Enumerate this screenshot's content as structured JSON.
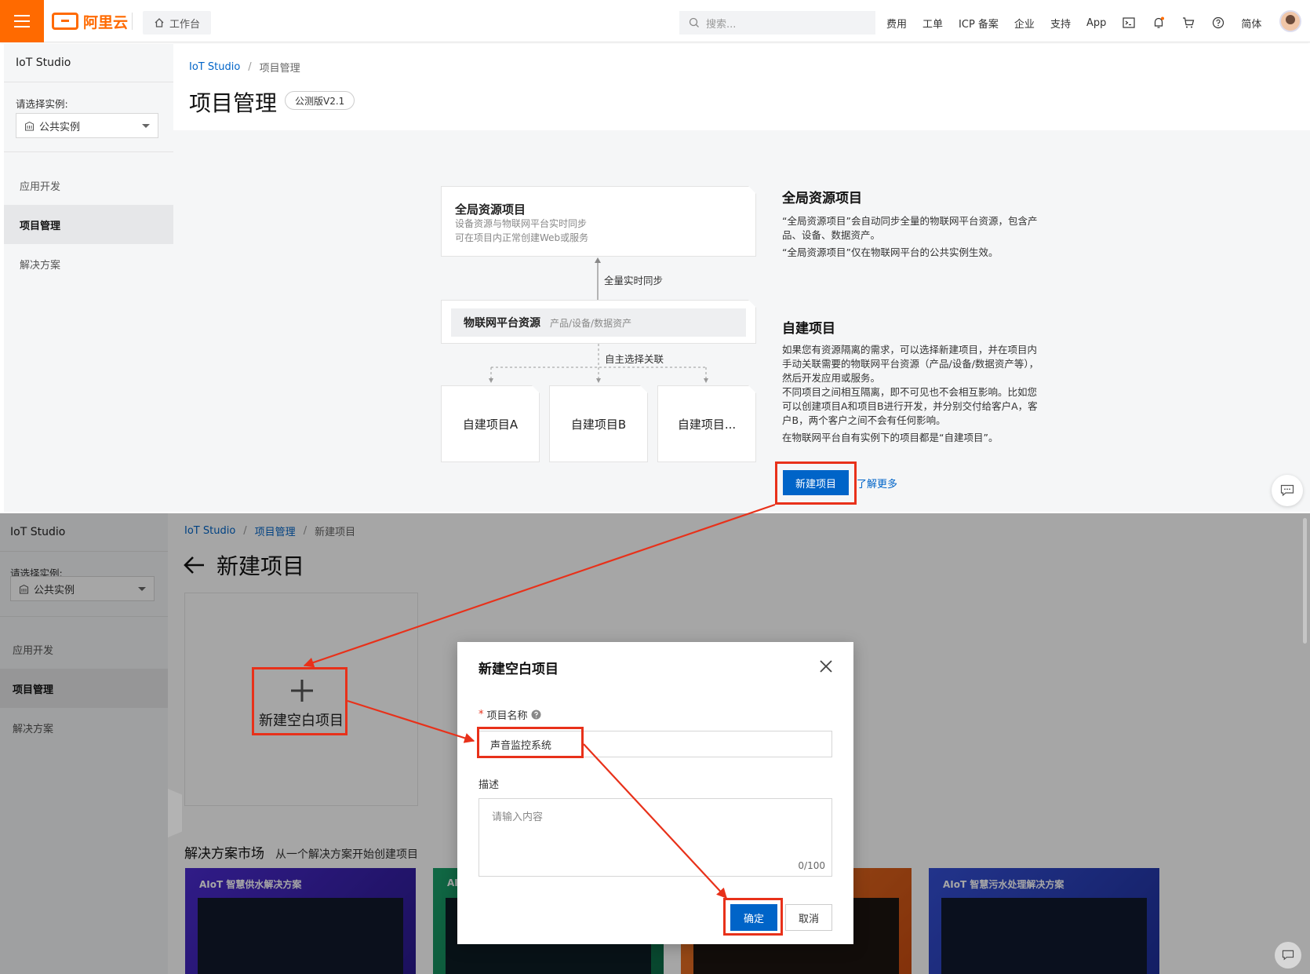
{
  "topbar": {
    "logo_text": "阿里云",
    "workbench": "工作台",
    "search_placeholder": "搜索...",
    "links": [
      "费用",
      "工单",
      "ICP 备案",
      "企业",
      "支持",
      "App"
    ],
    "lang": "简体"
  },
  "top_panel": {
    "sidebar": {
      "title": "IoT Studio",
      "instance_label": "请选择实例:",
      "instance_value": "公共实例",
      "items": [
        {
          "label": "应用开发",
          "active": false
        },
        {
          "label": "项目管理",
          "active": true
        },
        {
          "label": "解决方案",
          "active": false
        }
      ]
    },
    "breadcrumb": [
      "IoT Studio",
      "项目管理"
    ],
    "page_title": "项目管理",
    "version_badge": "公测版V2.1",
    "diagram": {
      "global_card_title": "全局资源项目",
      "global_card_line1": "设备资源与物联网平台实时同步",
      "global_card_line2": "可在项目内正常创建Web或服务",
      "sync_label": "全量实时同步",
      "platform_title": "物联网平台资源",
      "platform_sub": "产品/设备/数据资产",
      "assoc_label": "自主选择关联",
      "sub_projects": [
        "自建项目A",
        "自建项目B",
        "自建项目..."
      ]
    },
    "info": {
      "global_title": "全局资源项目",
      "global_p1": "“全局资源项目”会自动同步全量的物联网平台资源，包含产品、设备、数据资产。",
      "global_p2": "“全局资源项目”仅在物联网平台的公共实例生效。",
      "custom_title": "自建项目",
      "custom_p1": "如果您有资源隔离的需求，可以选择新建项目，并在项目内手动关联需要的物联网平台资源（产品/设备/数据资产等），然后开发应用或服务。",
      "custom_p2": "不同项目之间相互隔离，即不可见也不会相互影响。比如您可以创建项目A和项目B进行开发，并分别交付给客户A，客户B，两个客户之间不会有任何影响。",
      "custom_p3": "在物联网平台自有实例下的项目都是“自建项目”。"
    },
    "new_project_button": "新建项目",
    "learn_more": "了解更多"
  },
  "bottom_panel": {
    "sidebar": {
      "title": "IoT Studio",
      "instance_label": "请选择实例:",
      "instance_value": "公共实例",
      "items": [
        {
          "label": "应用开发",
          "active": false
        },
        {
          "label": "项目管理",
          "active": true
        },
        {
          "label": "解决方案",
          "active": false
        }
      ]
    },
    "breadcrumb": [
      "IoT Studio",
      "项目管理",
      "新建项目"
    ],
    "page_title": "新建项目",
    "blank_card_label": "新建空白项目",
    "market_title": "解决方案市场",
    "market_subtitle": "从一个解决方案开始创建项目",
    "solutions": [
      {
        "title": "AIoT 智慧供水解决方案",
        "color": "#3a1fb0"
      },
      {
        "title": "AI",
        "color": "#0f8a5a"
      },
      {
        "title": "",
        "color": "#e0601b"
      },
      {
        "title": "AIoT 智慧污水处理解决方案",
        "color": "#2b3fbf"
      }
    ],
    "modal": {
      "title": "新建空白项目",
      "name_label": "项目名称",
      "name_value": "声音监控系统",
      "desc_label": "描述",
      "desc_placeholder": "请输入内容",
      "counter": "0/100",
      "ok": "确定",
      "cancel": "取消"
    }
  }
}
